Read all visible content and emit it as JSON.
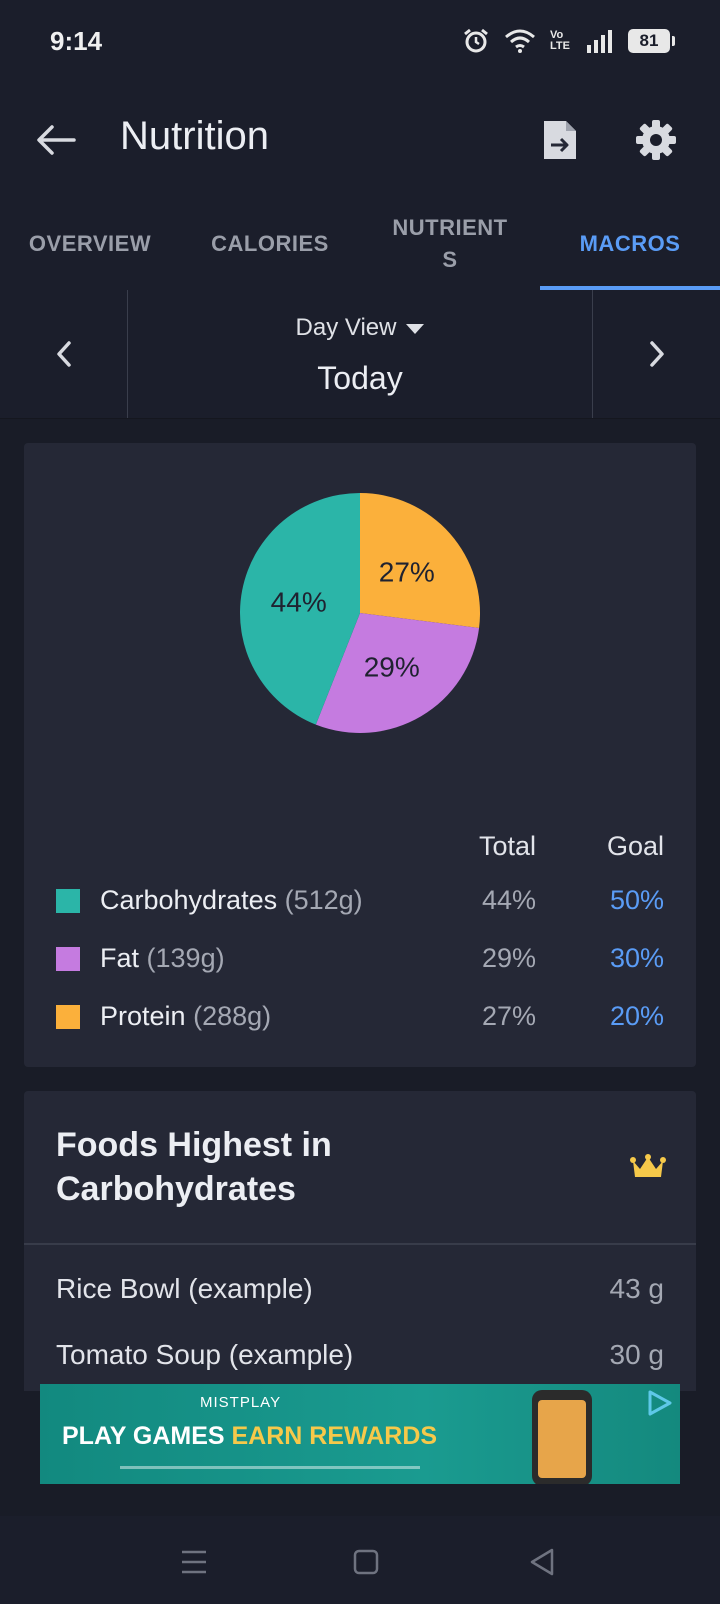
{
  "status_bar": {
    "time": "9:14",
    "network_label": "Vo LTE",
    "battery": "81"
  },
  "app_bar": {
    "title": "Nutrition"
  },
  "tabs": [
    {
      "label": "OVERVIEW",
      "active": false
    },
    {
      "label": "CALORIES",
      "active": false
    },
    {
      "label": "NUTRIENT\nS",
      "active": false
    },
    {
      "label": "MACROS",
      "active": true
    }
  ],
  "date_nav": {
    "view_mode": "Day View",
    "date_label": "Today"
  },
  "macros": {
    "table_headers": {
      "total": "Total",
      "goal": "Goal"
    },
    "rows": [
      {
        "name": "Carbohydrates",
        "grams": "(512g)",
        "total": "44%",
        "goal": "50%",
        "color": "#2bb5a8"
      },
      {
        "name": "Fat",
        "grams": "(139g)",
        "total": "29%",
        "goal": "30%",
        "color": "#c57be0"
      },
      {
        "name": "Protein",
        "grams": "(288g)",
        "total": "27%",
        "goal": "20%",
        "color": "#fbb03b"
      }
    ]
  },
  "chart_data": {
    "type": "pie",
    "title": "",
    "slices": [
      {
        "label": "Protein",
        "value": 27,
        "display": "27%",
        "color": "#fbb03b"
      },
      {
        "label": "Fat",
        "value": 29,
        "display": "29%",
        "color": "#c57be0"
      },
      {
        "label": "Carbohydrates",
        "value": 44,
        "display": "44%",
        "color": "#2bb5a8"
      }
    ]
  },
  "foods": {
    "title": "Foods Highest in Carbohydrates",
    "items": [
      {
        "name": "Rice Bowl (example)",
        "value": "43 g"
      },
      {
        "name": "Tomato Soup (example)",
        "value": "30 g"
      }
    ]
  },
  "ad": {
    "brand": "MISTPLAY",
    "headline_part1": "PLAY GAMES ",
    "headline_part2": "EARN REWARDS"
  },
  "colors": {
    "background": "#1b1e2b",
    "card": "#252836",
    "accent": "#5a9cf6",
    "crown": "#f6c94a"
  }
}
